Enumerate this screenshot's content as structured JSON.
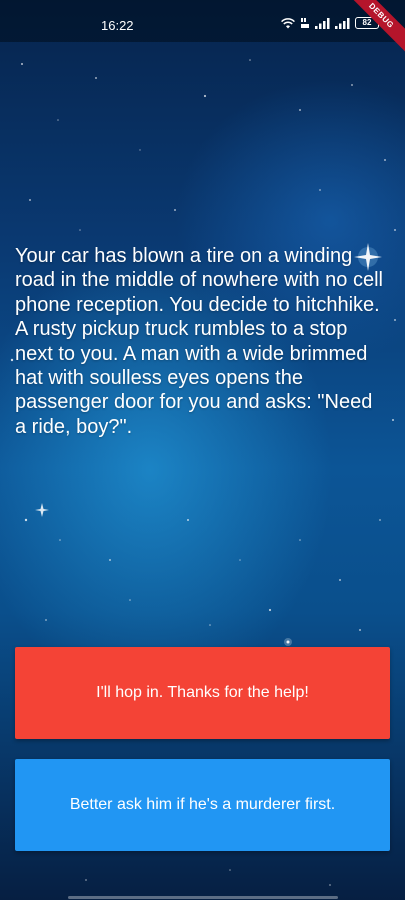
{
  "status_bar": {
    "time": "16:22",
    "battery_level": "82",
    "icons": [
      "wifi-icon",
      "volte-icon",
      "signal-icon",
      "signal-icon",
      "battery-icon"
    ]
  },
  "debug_banner": "DEBUG",
  "story": {
    "text": "Your car has blown a tire on a winding road in the middle of nowhere with no cell phone reception. You decide to hitchhike. A rusty pickup truck rumbles to a stop next to you. A man with a wide brimmed hat with soulless eyes opens the passenger door for you and asks: \"Need a ride, boy?\"."
  },
  "choices": [
    {
      "label": "I'll hop in. Thanks for the help!",
      "color": "#f44336"
    },
    {
      "label": "Better ask him if he's a murderer first.",
      "color": "#2196f3"
    }
  ],
  "colors": {
    "background_top": "#06244d",
    "background_glow": "#28aaeb",
    "choice_red": "#f44336",
    "choice_blue": "#2196f3",
    "debug_ribbon": "#b5152b"
  }
}
